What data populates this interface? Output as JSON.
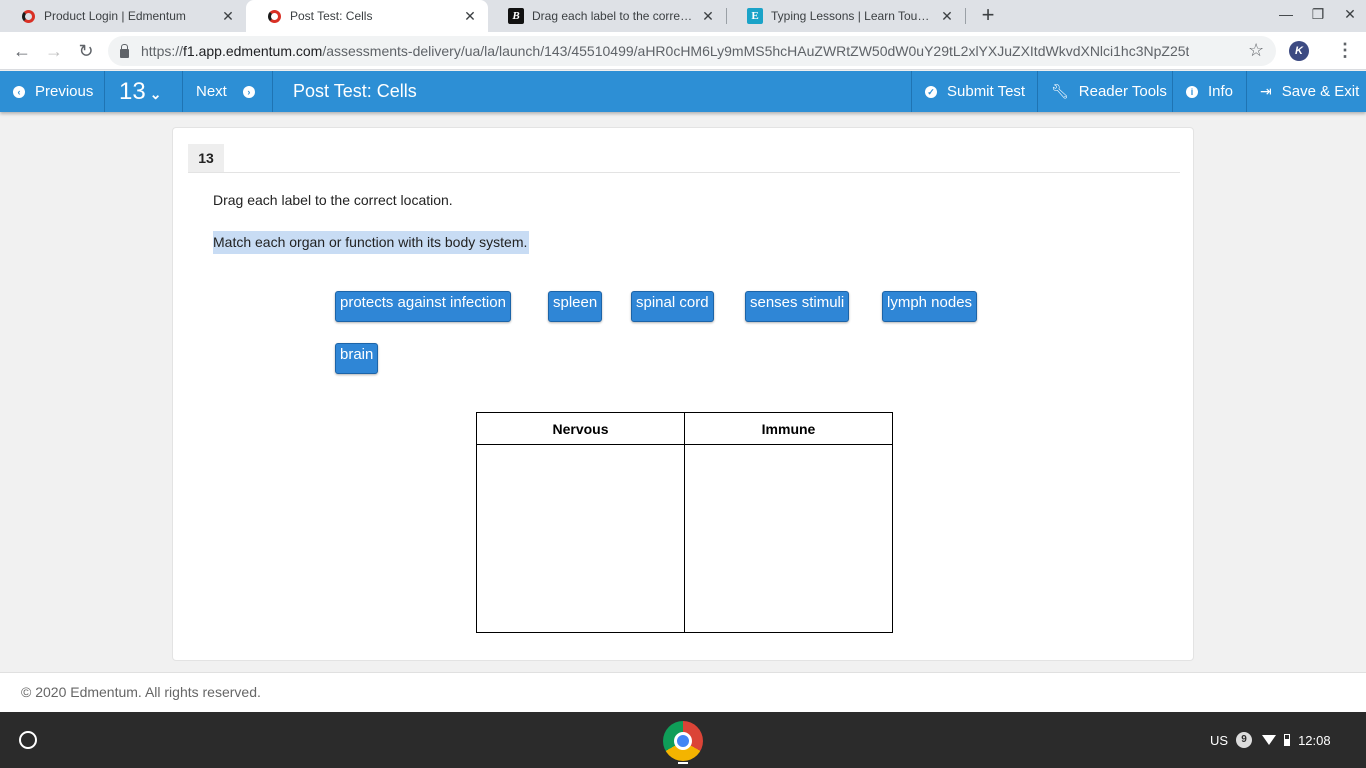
{
  "browser": {
    "tabs": [
      {
        "title": "Product Login | Edmentum",
        "active": false
      },
      {
        "title": "Post Test: Cells",
        "active": true
      },
      {
        "title": "Drag each label to the correct location",
        "active": false
      },
      {
        "title": "Typing Lessons | Learn Touch Typing",
        "active": false
      }
    ],
    "new_tab_glyph": "+",
    "url": {
      "scheme": "https://",
      "host": "f1.app.edmentum.com",
      "path": "/assessments-delivery/ua/la/launch/143/45510499/aHR0cHM6Ly9mMS5hcHAuZWRtZW50dW0uY29tL2xlYXJuZXItdWkvdXNlci1hc3NpZ25t"
    }
  },
  "appbar": {
    "previous_label": "Previous",
    "question_number": "13",
    "next_label": "Next",
    "title": "Post Test: Cells",
    "submit_label": "Submit Test",
    "reader_tools_label": "Reader Tools",
    "info_label": "Info",
    "save_exit_label": "Save & Exit"
  },
  "question": {
    "number": "13",
    "instruction": "Drag each label to the correct location.",
    "prompt": "Match each organ or function with its body system.",
    "labels": [
      "protects against infection",
      "spleen",
      "spinal cord",
      "senses stimuli",
      "lymph nodes",
      "brain"
    ],
    "columns": [
      "Nervous",
      "Immune"
    ]
  },
  "footer": {
    "copyright": "© 2020 Edmentum. All rights reserved."
  },
  "system_tray": {
    "keyboard_layout": "US",
    "notification_count": "9",
    "time": "12:08"
  }
}
